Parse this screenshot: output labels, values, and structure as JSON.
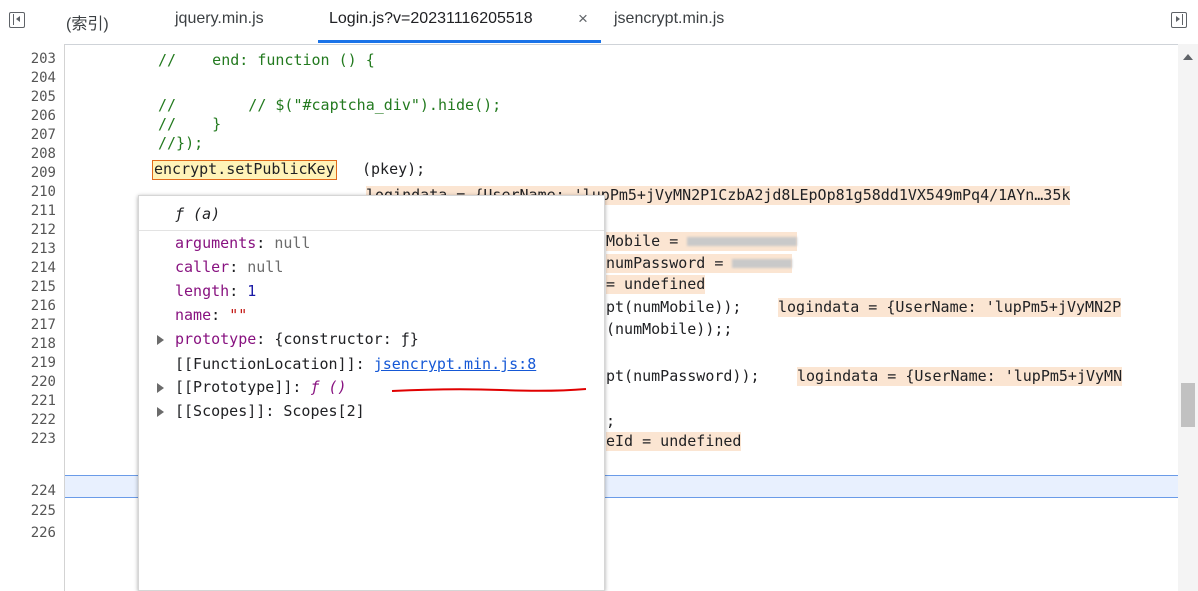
{
  "tabs": {
    "index": "(索引)",
    "jquery": "jquery.min.js",
    "login": "Login.js?v=20231116205518",
    "close": "×",
    "jsencrypt": "jsencrypt.min.js"
  },
  "gutter": [
    "203",
    "204",
    "205",
    "206",
    "207",
    "208",
    "209",
    "210",
    "211",
    "212",
    "213",
    "214",
    "215",
    "216",
    "217",
    "218",
    "219",
    "220",
    "221",
    "222",
    "223",
    "224",
    "225",
    "226"
  ],
  "code": {
    "l203": "//    end: function () {",
    "l205a": "//        // $(\"#captcha_div\").hide();",
    "l206": "//    }",
    "l207": "//});",
    "l208_token": "encrypt.setPublicKey",
    "l208_rest": "(pkey);",
    "l209_hint": "logindata = {UserName: 'lupPm5+jVyMN2P1CzbA2jd8LEpOp81g58dd1VX549mPq4/1AYn…35k",
    "l211": "Mobile = ",
    "l212": "numPassword = ",
    "l213": "= undefined",
    "l214": "pt(numMobile));",
    "l214_hint": "logindata = {UserName: 'lupPm5+jVyMN2P",
    "l215": "(numMobile));;",
    "l217": "pt(numPassword));",
    "l217_hint": "logindata = {UserName: 'lupPm5+jVyMN",
    "l219": ";",
    "l220": "eId = undefined"
  },
  "popover": {
    "title": "ƒ (a)",
    "arguments_key": "arguments",
    "arguments_val": "null",
    "caller_key": "caller",
    "caller_val": "null",
    "length_key": "length",
    "length_val": "1",
    "name_key": "name",
    "name_val": "\"\"",
    "prototype_key": "prototype",
    "prototype_val": "{constructor: ƒ}",
    "location_key": "[[FunctionLocation]]",
    "location_val": "jsencrypt.min.js:8",
    "proto_key": "[[Prototype]]",
    "proto_val": "ƒ ()",
    "scopes_key": "[[Scopes]]",
    "scopes_val": "Scopes[2]"
  },
  "colors": {
    "accent": "#1a73e8",
    "comment": "#237a1f",
    "inline_hint_bg": "#fbe5d2",
    "token_border": "#e06a1a",
    "annotation_red": "#e00000"
  },
  "icons": {
    "nav_left": "toggle-navigator-icon",
    "nav_right": "toggle-debugger-icon",
    "scroll_up": "scroll-up-arrow-icon"
  }
}
